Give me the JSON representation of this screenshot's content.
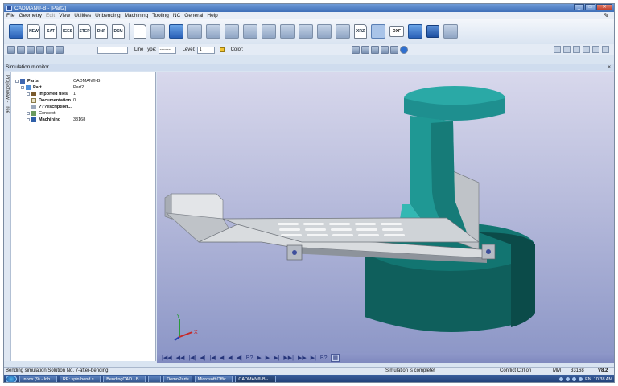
{
  "window": {
    "title": "CADMAN®-B - [Part2]"
  },
  "menu": [
    "File",
    "Geometry",
    "Edit",
    "View",
    "Utilities",
    "Unbending",
    "Machining",
    "Tooling",
    "NC",
    "General",
    "Help"
  ],
  "menu_disabled": [
    "Edit"
  ],
  "toolbar": {
    "file_buttons": [
      "NEW",
      "SAT",
      "IGES",
      "STEP",
      "DNF",
      "DSM"
    ],
    "xrz_label": "XRZ",
    "dxf_label": "DXF"
  },
  "props_bar": {
    "line_type_label": "Line Type:",
    "line_type_value": "--------",
    "level_label": "Level:",
    "level_value": "1",
    "color_label": "Color:"
  },
  "panel": {
    "title": "Simulation monitor",
    "side_tab": "Projectview - Tree"
  },
  "tree": [
    {
      "label": "Parts",
      "value": "CADMAN®-B",
      "icon": "parts-icon"
    },
    {
      "label": "Part",
      "value": "Part2",
      "icon": "part-icon"
    },
    {
      "label": "Imported files",
      "value": "1",
      "icon": "imported-files-icon"
    },
    {
      "label": "Documentation",
      "value": "0",
      "icon": "documentation-icon"
    },
    {
      "label": "???escription...",
      "value": "",
      "icon": "description-icon"
    },
    {
      "label": "Concept",
      "value": "",
      "icon": "concept-icon"
    },
    {
      "label": "Machining",
      "value": "33168",
      "icon": "machining-icon"
    }
  ],
  "axes": {
    "x": "X",
    "y": "Y"
  },
  "sim_controls": [
    "|◀◀",
    "◀◀",
    "|◀|",
    "◀|",
    "|◀",
    "◀",
    "◀",
    "◀|",
    "B?",
    "▶",
    "▶",
    "▶|",
    "▶▶|",
    "▶▶",
    "▶|",
    "B?",
    "▦"
  ],
  "status": {
    "left": "Bending simulation Solution No. 7-after-bending",
    "middle": "Simulation is complete!",
    "conflict": "Conflict Ctrl on",
    "unit": "MM",
    "number": "33168",
    "version": "V8.2"
  },
  "taskbar": {
    "items": [
      "Inbox (9) - Inb...",
      "RE: spin bend s...",
      "BendingCAD - B...",
      "",
      "DemoParts",
      "Microsoft Offic...",
      "CADMAN®-B - ..."
    ],
    "active_index": 6,
    "tray": {
      "lang": "EN",
      "time": "10:38 AM"
    }
  },
  "colors": {
    "sheet": "#d9dcdf",
    "tool_teal": "#1e8f8f",
    "die_base": "#0f5f5c",
    "viewport_top": "#d8d8ec",
    "viewport_bottom": "#8d97c7"
  }
}
